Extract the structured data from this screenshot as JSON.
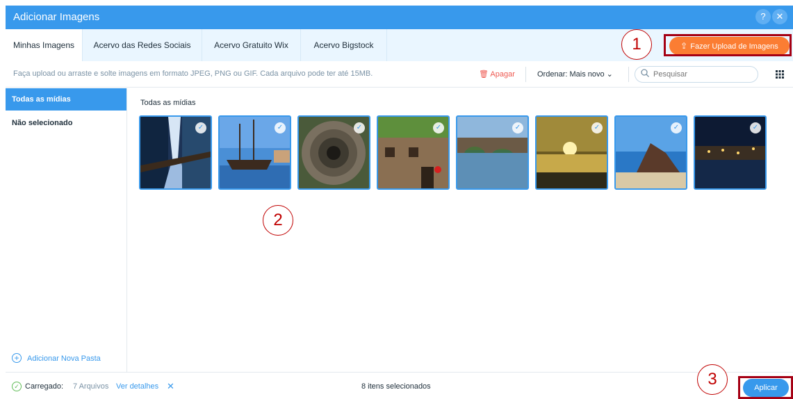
{
  "window": {
    "title": "Adicionar Imagens",
    "help_label": "?",
    "close_label": "✕"
  },
  "tabs": [
    {
      "label": "Minhas Imagens",
      "active": true
    },
    {
      "label": "Acervo das Redes Sociais"
    },
    {
      "label": "Acervo Gratuito Wix"
    },
    {
      "label": "Acervo Bigstock"
    }
  ],
  "upload_button": {
    "label": "Fazer Upload de Imagens",
    "icon": "upload-icon"
  },
  "toolbar": {
    "hint": "Faça upload ou arraste e solte imagens em formato JPEG, PNG ou GIF. Cada arquivo pode ter até 15MB.",
    "delete_label": "Apagar",
    "sort_label": "Ordenar: Mais novo",
    "search_placeholder": "Pesquisar"
  },
  "sidebar": {
    "items": [
      {
        "label": "Todas as mídias",
        "active": true
      },
      {
        "label": "Não selecionado"
      }
    ],
    "add_folder_label": "Adicionar Nova Pasta"
  },
  "main": {
    "title": "Todas as mídias",
    "images": [
      {
        "name": "waterfall",
        "selected": true
      },
      {
        "name": "caravel-ship",
        "selected": true
      },
      {
        "name": "spiral-well",
        "selected": true
      },
      {
        "name": "stone-house",
        "selected": true
      },
      {
        "name": "bridge-river",
        "selected": true
      },
      {
        "name": "sunset-lake",
        "selected": true
      },
      {
        "name": "coastal-rock",
        "selected": true
      },
      {
        "name": "night-harbor",
        "selected": true
      }
    ]
  },
  "footer": {
    "loaded_label": "Carregado:",
    "files_count": "7 Arquivos",
    "details_label": "Ver detalhes",
    "dismiss_label": "✕",
    "selected_count": "8 itens selecionados",
    "apply_label": "Aplicar"
  },
  "annotations": [
    "1",
    "2",
    "3"
  ],
  "colors": {
    "accent": "#3899ec",
    "upload": "#fb7d33",
    "danger": "#ee5951",
    "annotation": "#c00000"
  }
}
